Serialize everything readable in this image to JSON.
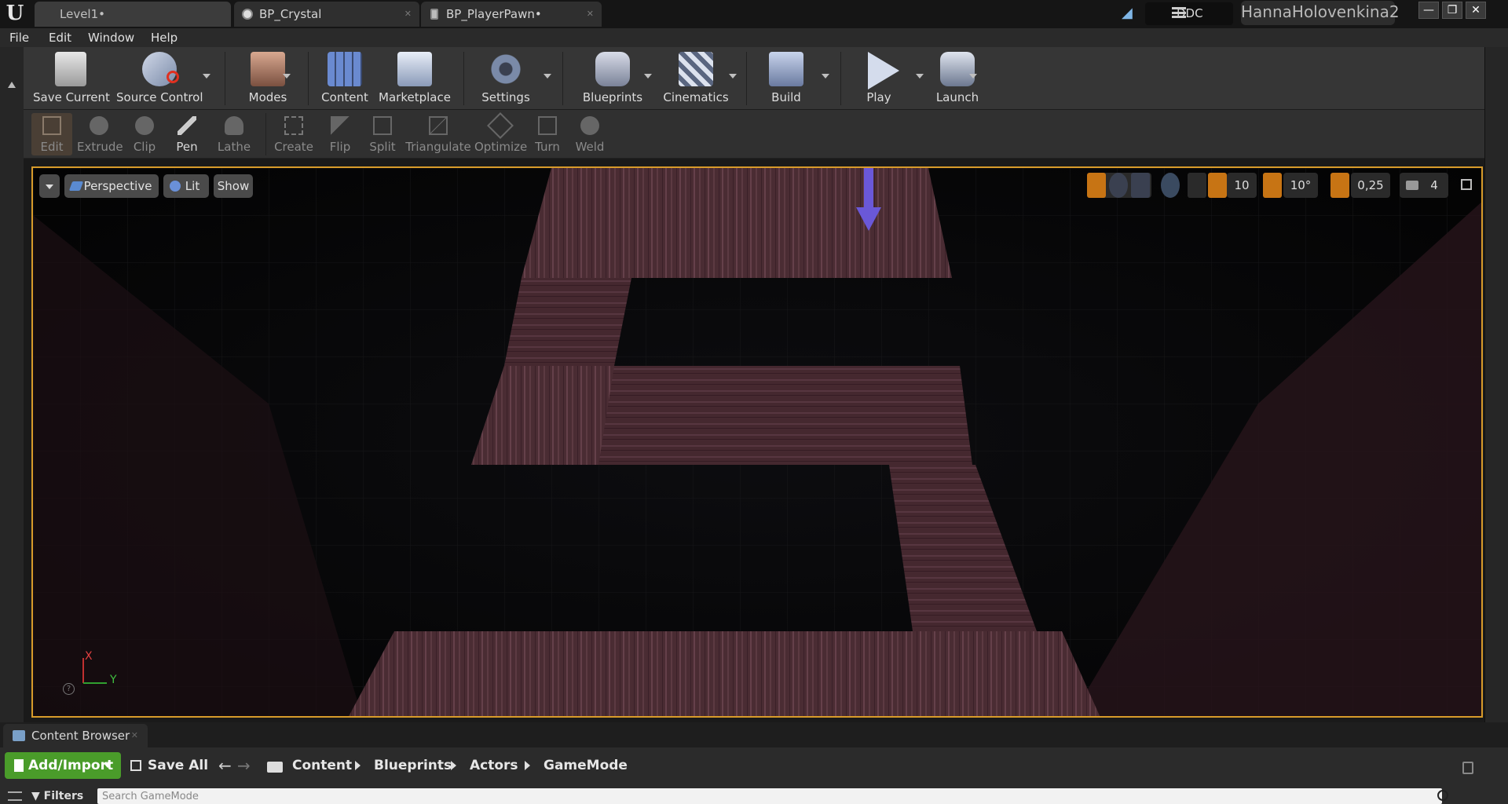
{
  "titlebar": {
    "tabs": [
      {
        "label": "Level1•"
      },
      {
        "label": "BP_Crystal"
      },
      {
        "label": "BP_PlayerPawn•"
      }
    ],
    "ddc_label": "DDC",
    "user": "HannaHolovenkina2",
    "window_buttons": [
      "—",
      "❐",
      "✕"
    ]
  },
  "menu": [
    "File",
    "Edit",
    "Window",
    "Help"
  ],
  "toolbar": [
    {
      "label": "Save Current"
    },
    {
      "label": "Source Control"
    },
    {
      "label": "Modes"
    },
    {
      "label": "Content"
    },
    {
      "label": "Marketplace"
    },
    {
      "label": "Settings"
    },
    {
      "label": "Blueprints"
    },
    {
      "label": "Cinematics"
    },
    {
      "label": "Build"
    },
    {
      "label": "Play"
    },
    {
      "label": "Launch"
    }
  ],
  "geometry_tools": [
    "Edit",
    "Extrude",
    "Clip",
    "Pen",
    "Lathe",
    "Create",
    "Flip",
    "Split",
    "Triangulate",
    "Optimize",
    "Turn",
    "Weld"
  ],
  "viewport": {
    "view_mode": "Perspective",
    "lighting": "Lit",
    "show": "Show",
    "grid_snap": "10",
    "rotation_snap": "10°",
    "scale_snap": "0,25",
    "camera_speed": "4",
    "axis_x": "X",
    "axis_y": "Y",
    "help": "?"
  },
  "content_browser": {
    "tab_label": "Content Browser",
    "add_import": "Add/Import",
    "save_all": "Save All",
    "breadcrumb": [
      "Content",
      "Blueprints",
      "Actors",
      "GameMode"
    ],
    "filters": "Filters",
    "search_placeholder": "Search GameMode"
  },
  "colors": {
    "viewport_border": "#d89b2a",
    "add_import_green": "#4a9c2a",
    "snap_orange": "#c77414",
    "floor_wood": "#4a2c33"
  }
}
